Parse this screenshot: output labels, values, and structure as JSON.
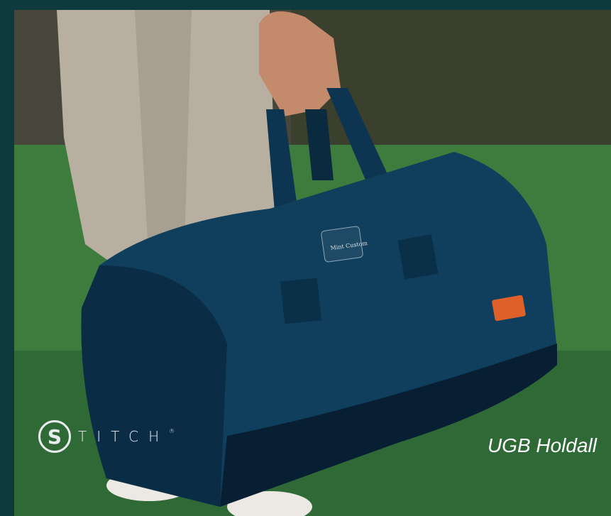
{
  "brand": {
    "letter": "S",
    "word": "TITCH",
    "trademark": "®"
  },
  "caption": "UGB Holdall",
  "colors": {
    "frame": "#0f3a3d",
    "bag": "#0f3f5c",
    "tag": "#e0602a"
  },
  "patch_text": "Mint Custom"
}
